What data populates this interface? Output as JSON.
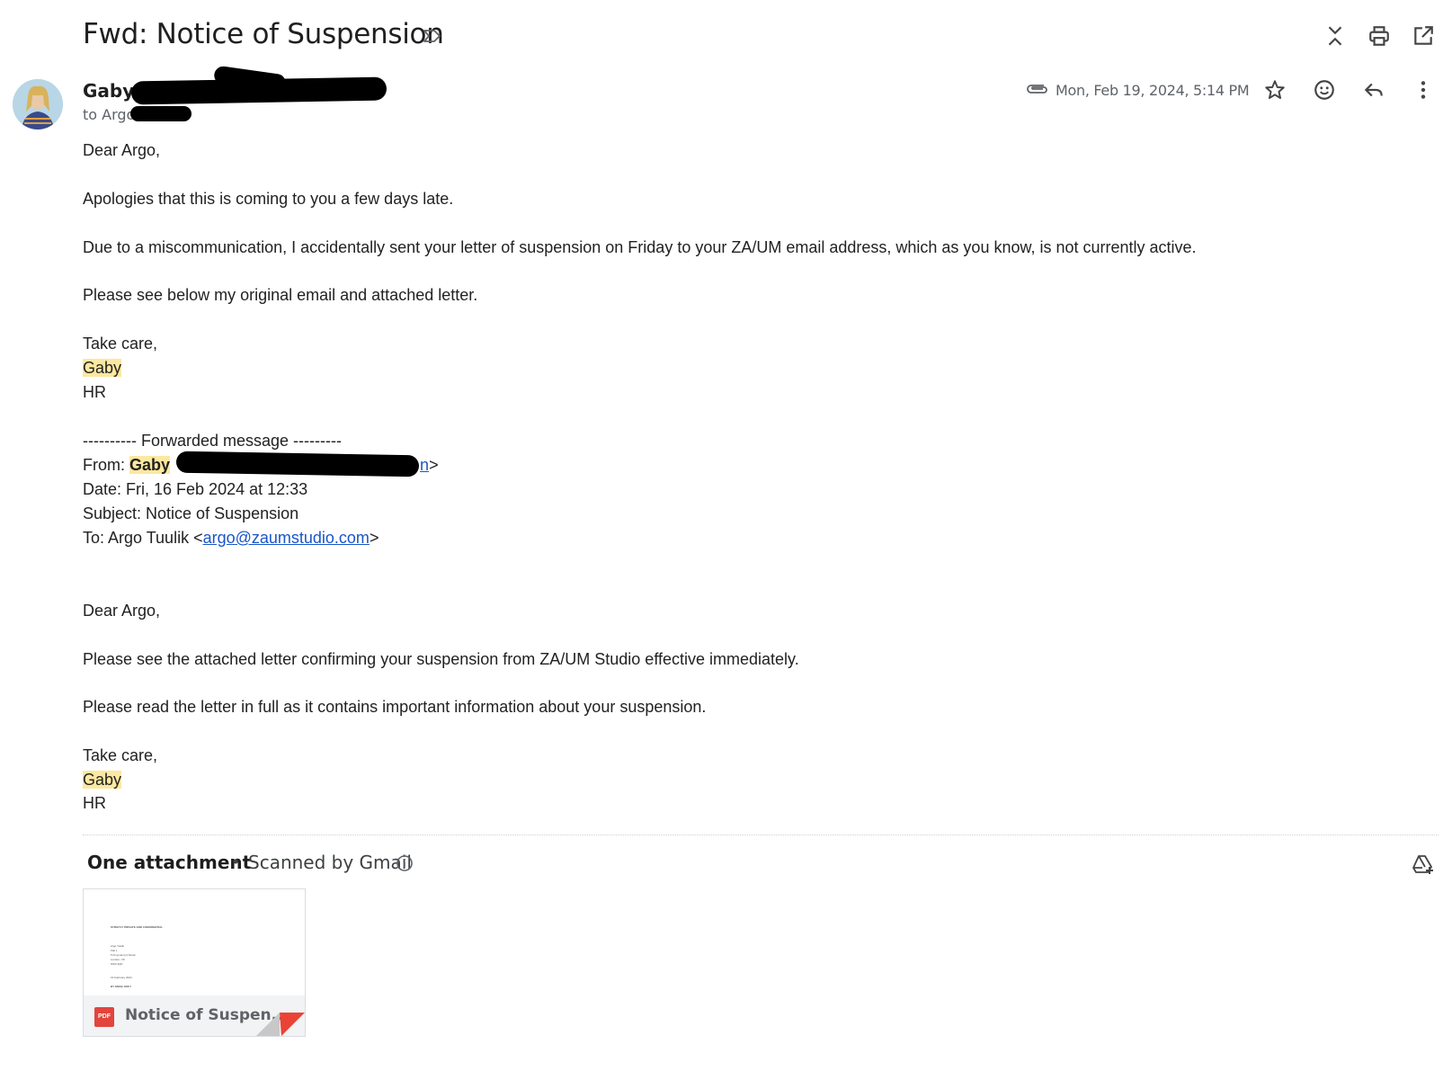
{
  "subject": "Fwd: Notice of Suspension",
  "sender": {
    "name": "Gaby",
    "recipient_line": "to Argo"
  },
  "date": "Mon, Feb 19, 2024, 5:14 PM",
  "body": {
    "greeting": "Dear Argo,",
    "p1": "Apologies that this is coming to you a few days late.",
    "p2": "Due to a miscommunication, I accidentally sent your letter of suspension on Friday to your ZA/UM email address, which as you know, is not currently active.",
    "p3": "Please see below my original email and attached letter.",
    "signoff": "Take care,",
    "sig_name": "Gaby",
    "sig_dept": "HR"
  },
  "forwarded": {
    "separator": "---------- Forwarded message ---------",
    "from_label": "From:",
    "from_name": "Gaby",
    "from_email_tail": "n",
    "from_close": ">",
    "date_line": "Date: Fri, 16 Feb 2024 at 12:33",
    "subject_line": "Subject: Notice of Suspension",
    "to_prefix": "To: Argo Tuulik <",
    "to_email": "argo@zaumstudio.com",
    "to_suffix": ">",
    "greeting": "Dear Argo,",
    "p1": "Please see the attached letter confirming your suspension from ZA/UM Studio effective immediately.",
    "p2": "Please read the letter in full as it contains important information about your suspension.",
    "signoff": "Take care,",
    "sig_name": "Gaby",
    "sig_dept": "HR"
  },
  "attachments": {
    "title": "One attachment",
    "dot": "•",
    "scanned": "Scanned by Gmail",
    "file_name": "Notice of Suspen...",
    "file_type": "PDF",
    "preview_lines": [
      "STRICTLY PRIVATE AND CONFIDENTIAL",
      "Argo Tuulik",
      "Flat 1",
      "5 King Henry's Road",
      "London, UK",
      "NW3 3QP",
      "16 February 2024",
      "BY EMAIL ONLY"
    ]
  },
  "icons": [
    "label-icon",
    "expand-collapse-icon",
    "print-icon",
    "open-in-new-window-icon",
    "attachment-clip-icon",
    "star-icon",
    "emoji-icon",
    "reply-icon",
    "more-vert-icon",
    "info-icon",
    "add-to-drive-icon",
    "pdf-icon"
  ],
  "colors": {
    "highlight": "#fce8a0",
    "link": "#1a55c8",
    "pdf_red": "#e2453c",
    "redaction": "#000000"
  }
}
